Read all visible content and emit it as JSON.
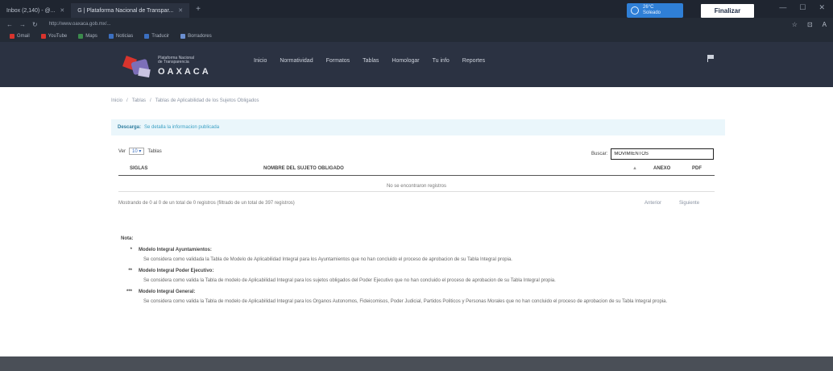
{
  "browser": {
    "tabs": [
      {
        "label": "Inbox (2,140) - @...",
        "active": false
      },
      {
        "label": "G | Plataforma Nacional de Transpar...",
        "active": true
      }
    ],
    "new_tab": "+",
    "url": "http://www.oaxaca.gob.mx/...",
    "weather": {
      "line1": "26°C",
      "line2": "Soleado"
    },
    "update_button": "Finalizar",
    "window_controls": [
      "—",
      "☐",
      "✕"
    ],
    "addr_right": [
      "☆",
      "⊡",
      "A"
    ],
    "bookmarks": [
      {
        "label": "Gmail",
        "color": "#d8342d"
      },
      {
        "label": "YouTube",
        "color": "#d8342d"
      },
      {
        "label": "Maps",
        "color": "#3b8a4c"
      },
      {
        "label": "Noticias",
        "color": "#3b6fc0"
      },
      {
        "label": "Traducir",
        "color": "#3b6fc0"
      },
      {
        "label": "Borradores",
        "color": "#6b8fd0"
      }
    ]
  },
  "site": {
    "logo_sub1": "Plataforma Nacional",
    "logo_sub2": "de Transparencia",
    "logo_main": "OAXACA",
    "nav": [
      "Inicio",
      "Normatividad",
      "Formatos",
      "Tablas",
      "Homologar",
      "Tu info",
      "Reportes"
    ]
  },
  "breadcrumb": [
    "Inicio",
    "/",
    "Tablas",
    "/",
    "Tablas de Aplicabilidad de los Sujetos Obligados"
  ],
  "alert": {
    "strong": "Descarga:",
    "text": "Se detalla la informacion publicada"
  },
  "length_control": {
    "show": "Ver",
    "value": "10",
    "suffix": "Tablas"
  },
  "search": {
    "label": "Buscar:",
    "value": "MOVIMIENTOS"
  },
  "table": {
    "headers": [
      "SIGLAS",
      "NOMBRE DEL SUJETO OBLIGADO",
      "ANEXO",
      "PDF"
    ],
    "sort_icon": "▲",
    "empty": "No se encontraron registros"
  },
  "info": "Mostrando de 0 al 0 de un total de 0 registros (filtrado de un total de 397 registros)",
  "pager": {
    "prev": "Anterior",
    "next": "Siguiente"
  },
  "notes": {
    "title": "Nota:",
    "items": [
      {
        "mark": "*",
        "head": "Modelo Integral Ayuntamientos:",
        "body": "Se considera como validada la Tabla de Modelo de Aplicabilidad Integral para los Ayuntamientos que no han concluido el proceso de aprobacion de su Tabla Integral propia."
      },
      {
        "mark": "**",
        "head": "Modelo Integral Poder Ejecutivo:",
        "body": "Se considera como valida la Tabla de modelo de Aplicabilidad Integral para los sujetos obligados del Poder Ejecutivo que no han concluido el proceso de aprobacion de su Tabla Integral propia."
      },
      {
        "mark": "***",
        "head": "Modelo Integral General:",
        "body": "Se considera como valida la Tabla de modelo de Aplicabilidad Integral para los Organos Autonomos, Fideicomisos, Poder Judicial, Partidos Politicos y Personas Morales que no han concluido el proceso de aprobacion de su Tabla Integral propia."
      }
    ]
  }
}
